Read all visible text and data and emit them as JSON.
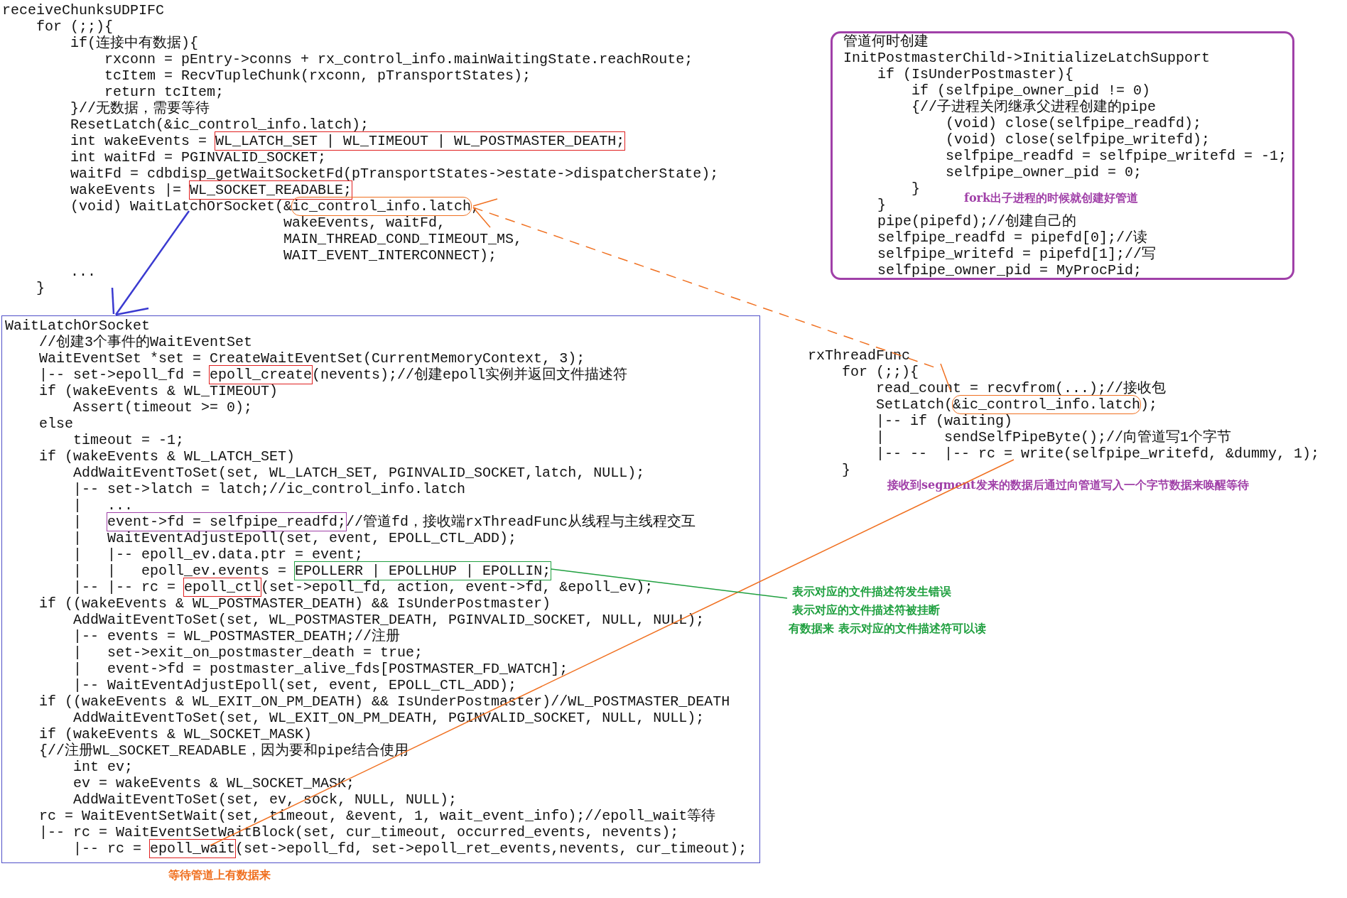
{
  "blocks": [
    {
      "lines": [
        "receiveChunksUDPIFC",
        "    for (;;){",
        "        if(连接中有数据){",
        "            rxconn = pEntry->conns + rx_control_info.mainWaitingState.reachRoute;",
        "            tcItem = RecvTupleChunk(rxconn, pTransportStates);",
        "            return tcItem;",
        "        }//无数据，需要等待",
        "        ResetLatch(&ic_control_info.latch);",
        [
          {
            "text": "        int wakeEvents = "
          },
          {
            "text": "WL_LATCH_SET | WL_TIMEOUT | WL_POSTMASTER_DEATH;",
            "kind": "box",
            "color": "#e02020"
          }
        ],
        "        int waitFd = PGINVALID_SOCKET;",
        "        waitFd = cdbdisp_getWaitSocketFd(pTransportStates->estate->dispatcherState);",
        [
          {
            "text": "        wakeEvents |= "
          },
          {
            "text": "WL_SOCKET_READABLE;",
            "kind": "box",
            "color": "#e02020"
          }
        ],
        [
          {
            "text": "        (void) WaitLatchOrSocket(&"
          },
          {
            "text": "ic_control_info.latch",
            "kind": "oval",
            "color": "#f07020"
          },
          {
            "text": ","
          }
        ],
        "                                 wakeEvents, waitFd,",
        "                                 MAIN_THREAD_COND_TIMEOUT_MS,",
        "                                 WAIT_EVENT_INTERCONNECT);",
        "        ...",
        "    }"
      ]
    },
    {
      "color": "#a040a8",
      "lines": [
        "管道何时创建",
        "InitPostmasterChild->InitializeLatchSupport",
        "    if (IsUnderPostmaster){",
        "        if (selfpipe_owner_pid != 0)",
        "        {//子进程关闭继承父进程创建的pipe",
        "            (void) close(selfpipe_readfd);",
        "            (void) close(selfpipe_writefd);",
        "            selfpipe_readfd = selfpipe_writefd = -1;",
        "            selfpipe_owner_pid = 0;",
        "        }",
        "    }",
        "    pipe(pipefd);//创建自己的",
        "    selfpipe_readfd = pipefd[0];//读",
        "    selfpipe_writefd = pipefd[1];//写",
        "    selfpipe_owner_pid = MyProcPid;"
      ]
    },
    {
      "color": "#5050c8",
      "lines": [
        "WaitLatchOrSocket",
        "    //创建3个事件的WaitEventSet",
        "    WaitEventSet *set = CreateWaitEventSet(CurrentMemoryContext, 3);",
        [
          {
            "text": "    |-- set->epoll_fd = "
          },
          {
            "text": "epoll_create",
            "kind": "box",
            "color": "#e02020"
          },
          {
            "text": "(nevents);//创建epoll实例并返回文件描述符"
          }
        ],
        "    if (wakeEvents & WL_TIMEOUT)",
        "        Assert(timeout >= 0);",
        "    else",
        "        timeout = -1;",
        "    if (wakeEvents & WL_LATCH_SET)",
        "        AddWaitEventToSet(set, WL_LATCH_SET, PGINVALID_SOCKET,latch, NULL);",
        "        |-- set->latch = latch;//ic_control_info.latch",
        "        |   ...",
        [
          {
            "text": "        |   "
          },
          {
            "text": "event->fd = selfpipe_readfd;",
            "kind": "box",
            "color": "#a040a8"
          },
          {
            "text": "//管道fd，接收端rxThreadFunc从线程与主线程交互"
          }
        ],
        "        |   WaitEventAdjustEpoll(set, event, EPOLL_CTL_ADD);",
        "        |   |-- epoll_ev.data.ptr = event;",
        [
          {
            "text": "        |   |   epoll_ev.events = "
          },
          {
            "text": "EPOLLERR | EPOLLHUP | EPOLLIN;",
            "kind": "box",
            "color": "#20a040"
          }
        ],
        [
          {
            "text": "        |-- |-- rc = "
          },
          {
            "text": "epoll_ctl",
            "kind": "box",
            "color": "#e02020"
          },
          {
            "text": "(set->epoll_fd, action, event->fd, &epoll_ev);"
          }
        ],
        "    if ((wakeEvents & WL_POSTMASTER_DEATH) && IsUnderPostmaster)",
        "        AddWaitEventToSet(set, WL_POSTMASTER_DEATH, PGINVALID_SOCKET, NULL, NULL);",
        "        |-- events = WL_POSTMASTER_DEATH;//注册",
        "        |   set->exit_on_postmaster_death = true;",
        "        |   event->fd = postmaster_alive_fds[POSTMASTER_FD_WATCH];",
        "        |-- WaitEventAdjustEpoll(set, event, EPOLL_CTL_ADD);",
        "    if ((wakeEvents & WL_EXIT_ON_PM_DEATH) && IsUnderPostmaster)//WL_POSTMASTER_DEATH",
        "        AddWaitEventToSet(set, WL_EXIT_ON_PM_DEATH, PGINVALID_SOCKET, NULL, NULL);",
        "    if (wakeEvents & WL_SOCKET_MASK)",
        "    {//注册WL_SOCKET_READABLE，因为要和pipe结合使用",
        "        int ev;",
        "        ev = wakeEvents & WL_SOCKET_MASK;",
        "        AddWaitEventToSet(set, ev, sock, NULL, NULL);",
        "    rc = WaitEventSetWait(set, timeout, &event, 1, wait_event_info);//epoll_wait等待",
        "    |-- rc = WaitEventSetWaitBlock(set, cur_timeout, occurred_events, nevents);",
        [
          {
            "text": "        |-- rc = "
          },
          {
            "text": "epoll_wait",
            "kind": "box",
            "color": "#e02020"
          },
          {
            "text": "(set->epoll_fd, set->epoll_ret_events,nevents, cur_timeout);"
          }
        ]
      ]
    },
    {
      "lines": [
        "rxThreadFunc",
        "    for (;;){",
        "        read_count = recvfrom(...);//接收包",
        [
          {
            "text": "        SetLatch("
          },
          {
            "text": "&ic_control_info.latch",
            "kind": "oval",
            "color": "#f07020"
          },
          {
            "text": ");"
          }
        ],
        "        |-- if (waiting)",
        "        |       sendSelfPipeByte();//向管道写1个字节",
        "        |-- --  |-- rc = write(selfpipe_writefd, &dummy, 1);",
        "    }"
      ]
    }
  ],
  "notes": [
    {
      "text": "fork出子进程的时候就创建好管道",
      "color": "#a040a8"
    },
    {
      "text": "接收到segment发来的数据后通过向管道写入一个字节数据来唤醒等待",
      "color": "#a040a8"
    },
    {
      "text": "表示对应的文件描述符发生错误",
      "color": "#20a040"
    },
    {
      "text": "表示对应的文件描述符被挂断",
      "color": "#20a040"
    },
    {
      "text": "有数据来 表示对应的文件描述符可以读",
      "color": "#20a040"
    },
    {
      "text": "等待管道上有数据来",
      "color": "#f07020"
    }
  ]
}
